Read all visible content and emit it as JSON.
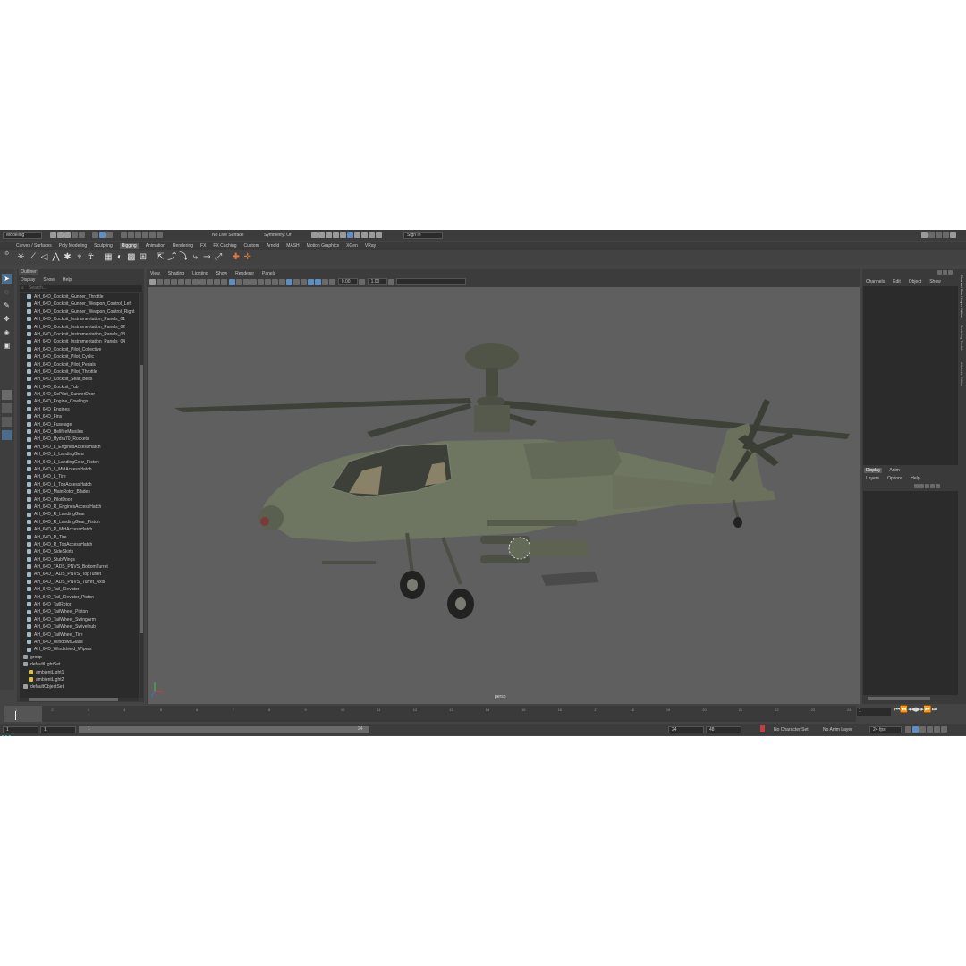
{
  "status_line": {
    "mode": "Modeling",
    "live_surface": "No Live Surface",
    "symmetry": "Symmetry: Off",
    "sign_in": "Sign In"
  },
  "shelf_tabs": [
    "Curves / Surfaces",
    "Poly Modeling",
    "Sculpting",
    "Rigging",
    "Animation",
    "Rendering",
    "FX",
    "FX Caching",
    "Custom",
    "Arnold",
    "MASH",
    "Motion Graphics",
    "XGen",
    "VRay"
  ],
  "outliner": {
    "title": "Outliner",
    "menu": [
      "Display",
      "Show",
      "Help"
    ],
    "search_placeholder": "Search...",
    "items": [
      "AH_64D_Cockpit_Gunner_Throttle",
      "AH_64D_Cockpit_Gunner_Weapon_Control_Left",
      "AH_64D_Cockpit_Gunner_Weapon_Control_Right",
      "AH_64D_Cockpit_Instrumentation_Panels_01",
      "AH_64D_Cockpit_Instrumentation_Panels_02",
      "AH_64D_Cockpit_Instrumentation_Panels_03",
      "AH_64D_Cockpit_Instrumentation_Panels_04",
      "AH_64D_Cockpit_Pilot_Collective",
      "AH_64D_Cockpit_Pilot_Cyclic",
      "AH_64D_Cockpit_Pilot_Pedals",
      "AH_64D_Cockpit_Pilot_Throttle",
      "AH_64D_Cockpit_Seat_Belts",
      "AH_64D_Cockpit_Tub",
      "AH_64D_CoPilot_GunnerDoor",
      "AH_64D_Engine_Cowlings",
      "AH_64D_Engines",
      "AH_64D_Fins",
      "AH_64D_Fuselage",
      "AH_64D_HellfireMissiles",
      "AH_64D_Hydra70_Rockets",
      "AH_64D_L_EnginesAccessHatch",
      "AH_64D_L_LandingGear",
      "AH_64D_L_LandingGear_Piston",
      "AH_64D_L_MidAccessHatch",
      "AH_64D_L_Tire",
      "AH_64D_L_TopAccessHatch",
      "AH_64D_MainRotor_Blades",
      "AH_64D_PilotDoor",
      "AH_64D_R_EnginesAccessHatch",
      "AH_64D_R_LandingGear",
      "AH_64D_R_LandingGear_Piston",
      "AH_64D_R_MidAccessHatch",
      "AH_64D_R_Tire",
      "AH_64D_R_TopAccessHatch",
      "AH_64D_SideSkirts",
      "AH_64D_StubWings",
      "AH_64D_TADS_PNVS_BottomTurret",
      "AH_64D_TADS_PNVS_TopTurret",
      "AH_64D_TADS_PNVS_Turret_Axis",
      "AH_64D_Tail_Elevator",
      "AH_64D_Tail_Elevator_Piston",
      "AH_64D_TailRotor",
      "AH_64D_TailWheel_Piston",
      "AH_64D_TailWheel_SwingArm",
      "AH_64D_TailWheel_Swivelhub",
      "AH_64D_TailWheel_Tire",
      "AH_64D_WindowsGlass",
      "AH_64D_Windshield_Wipers"
    ],
    "tail_items": [
      {
        "label": "group",
        "indent": 1
      },
      {
        "label": "defaultLightSet",
        "indent": 1
      },
      {
        "label": "ambientLight1",
        "indent": 2
      },
      {
        "label": "ambientLight2",
        "indent": 2
      },
      {
        "label": "defaultObjectSet",
        "indent": 1
      }
    ]
  },
  "viewport": {
    "menu": [
      "View",
      "Shading",
      "Lighting",
      "Show",
      "Renderer",
      "Panels"
    ],
    "field1": "0.00",
    "field2": "1.00",
    "camera_label": "persp"
  },
  "channel_box": {
    "menu": [
      "Channels",
      "Edit",
      "Object",
      "Show"
    ]
  },
  "layer_editor": {
    "tabs": [
      "Display",
      "Anim"
    ],
    "menu": [
      "Layers",
      "Options",
      "Help"
    ]
  },
  "side_tabs": [
    "Channel Box / Layer Editor",
    "Modeling Toolkit",
    "Attribute Editor"
  ],
  "timeline": {
    "ticks": [
      "1",
      "2",
      "3",
      "4",
      "5",
      "6",
      "7",
      "8",
      "9",
      "10",
      "11",
      "12",
      "13",
      "14",
      "15",
      "16",
      "17",
      "18",
      "19",
      "20",
      "21",
      "22",
      "23",
      "24"
    ],
    "current_frame": "1"
  },
  "range": {
    "start": "1",
    "start2": "1",
    "slider_start": "1",
    "slider_end": "24",
    "end": "24",
    "end2": "48",
    "character_set": "No Character Set",
    "anim_layer": "No Anim Layer",
    "fps": "24 fps"
  },
  "colors": {
    "background": "#444444",
    "panel": "#3c3c3c",
    "viewport": "#5f5f5f",
    "accent": "#5e8fc0",
    "helicopter": "#6e7560"
  }
}
